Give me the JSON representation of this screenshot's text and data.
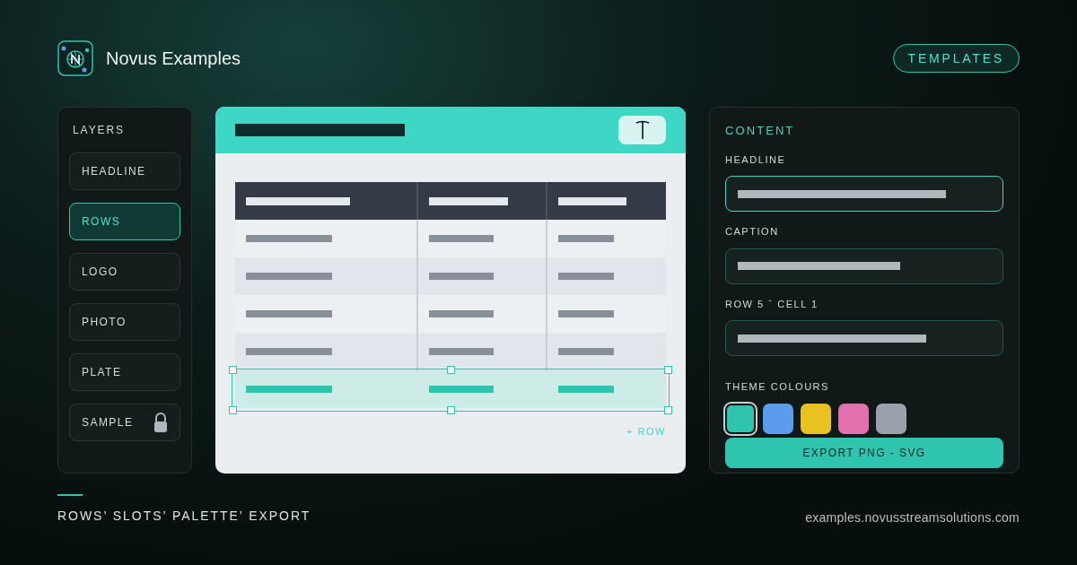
{
  "brand": {
    "title": "Novus Examples"
  },
  "templates_button": {
    "label": "TEMPLATES"
  },
  "layers": {
    "title": "LAYERS",
    "items": [
      {
        "label": "HEADLINE",
        "selected": false,
        "locked": false
      },
      {
        "label": "ROWS",
        "selected": true,
        "locked": false
      },
      {
        "label": "LOGO",
        "selected": false,
        "locked": false
      },
      {
        "label": "PHOTO",
        "selected": false,
        "locked": false
      },
      {
        "label": "PLATE",
        "selected": false,
        "locked": false
      },
      {
        "label": "SAMPLE",
        "selected": false,
        "locked": true
      }
    ]
  },
  "canvas": {
    "rows": [
      {
        "selected": false
      },
      {
        "selected": false
      },
      {
        "selected": false
      },
      {
        "selected": false
      },
      {
        "selected": true
      }
    ],
    "add_row": "+ ROW"
  },
  "content": {
    "title": "CONTENT",
    "fields": [
      {
        "label": "HEADLINE",
        "focused": true
      },
      {
        "label": "CAPTION",
        "focused": false
      },
      {
        "label": "ROW 5 ˉ CELL 1",
        "focused": false
      }
    ],
    "theme_label": "THEME COLOURS",
    "swatches": [
      {
        "color": "#2ec4ae",
        "selected": true
      },
      {
        "color": "#5b9cec",
        "selected": false
      },
      {
        "color": "#e8c21e",
        "selected": false
      },
      {
        "color": "#e070ae",
        "selected": false
      },
      {
        "color": "#9aa1ab",
        "selected": false
      }
    ],
    "export_button": "EXPORT PNG - SVG"
  },
  "footer": {
    "tagline": "ROWS’ SLOTS’ PALETTE’ EXPORT",
    "url": "examples.novusstreamsolutions.com"
  }
}
